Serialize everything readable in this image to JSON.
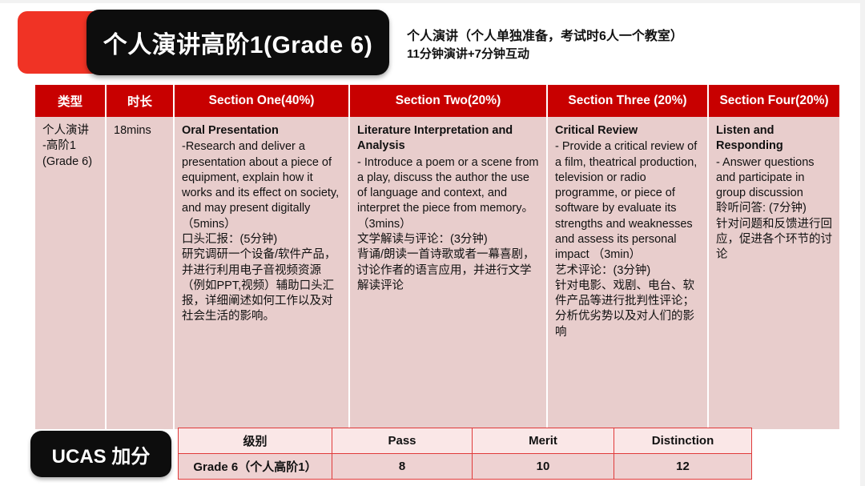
{
  "header": {
    "title_badge": "个人演讲高阶1(Grade 6)",
    "note_line_1": "个人演讲（个人单独准备，考试时6人一个教室）",
    "note_line_2": "11分钟演讲+7分钟互动",
    "accent_red": "#f03325",
    "badge_black": "#0d0d0d"
  },
  "main_table": {
    "header_bg": "#c80000",
    "cell_bg": "#e8cdcc",
    "columns": [
      {
        "label": "类型"
      },
      {
        "label": "时长"
      },
      {
        "label": "Section One(40%)"
      },
      {
        "label": "Section Two(20%)"
      },
      {
        "label": "Section Three (20%)"
      },
      {
        "label": "Section Four(20%)"
      }
    ],
    "row": {
      "type": "个人演讲\n-高阶1\n(Grade 6)",
      "duration": "18mins",
      "section_one": {
        "title": "Oral Presentation",
        "body": "-Research and deliver a presentation about a piece of equipment, explain how it works and its effect on society, and may present digitally （5mins）",
        "cn": "口头汇报：(5分钟)\n研究调研一个设备/软件产品，并进行利用电子音视频资源（例如PPT,视频）辅助口头汇报，详细阐述如何工作以及对社会生活的影响。"
      },
      "section_two": {
        "title": "Literature Interpretation and Analysis",
        "body": "- Introduce a poem or a scene from a play, discuss the author the use of language and context, and interpret the piece from memory。 （3mins）",
        "cn": "文学解读与评论：(3分钟)\n背诵/朗读一首诗歌或者一幕喜剧，讨论作者的语言应用，并进行文学解读评论"
      },
      "section_three": {
        "title": "Critical Review",
        "body": "- Provide a critical review of a film, theatrical production, television or radio programme, or piece of software by evaluate its strengths and weaknesses and assess its personal impact （3min）",
        "cn": "艺术评论：(3分钟)\n针对电影、戏剧、电台、软件产品等进行批判性评论；分析优劣势以及对人们的影响"
      },
      "section_four": {
        "title": "Listen and Responding",
        "body": " - Answer questions and participate in group discussion",
        "cn": "聆听问答: (7分钟)\n针对问题和反馈进行回应，促进各个环节的讨论"
      }
    }
  },
  "ucas": {
    "badge_label": "UCAS 加分",
    "columns": [
      "级别",
      "Pass",
      "Merit",
      "Distinction"
    ],
    "row": [
      "Grade 6（个人高阶1）",
      "8",
      "10",
      "12"
    ],
    "border_color": "#e03a3a",
    "header_bg": "#fae7e7",
    "row_bg": "#eed2d2"
  }
}
